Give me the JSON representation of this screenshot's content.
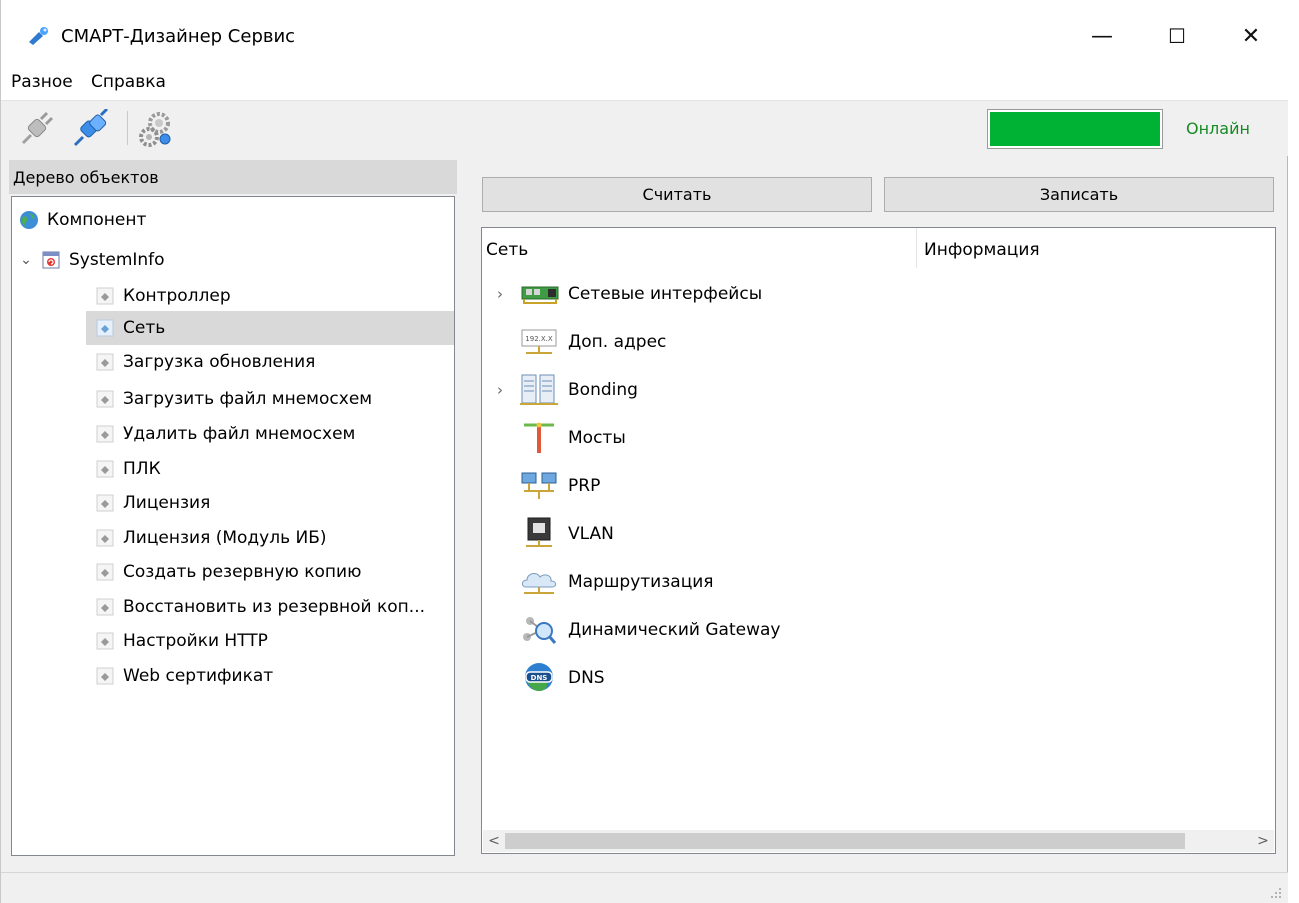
{
  "window": {
    "title": "СМАРТ-Дизайнер Сервис",
    "minimize": "—",
    "maximize": "☐",
    "close": "✕"
  },
  "menu": {
    "items": [
      {
        "label": "Разное"
      },
      {
        "label": "Справка"
      }
    ]
  },
  "toolbar": {
    "tools": [
      {
        "icon": "disconnect-plug-icon"
      },
      {
        "icon": "connect-plug-icon"
      },
      {
        "icon": "gear-icon"
      }
    ],
    "status": {
      "label": "Онлайн",
      "color": "#00b233",
      "fill": 1.0
    }
  },
  "left_panel": {
    "header": "Дерево объектов",
    "tree": {
      "root": {
        "label": "Компонент",
        "icon": "globe-icon"
      },
      "group": {
        "label": "SystemInfo",
        "icon": "systeminfo-icon",
        "expanded": true
      },
      "items": [
        {
          "label": "Контроллер",
          "selected": false
        },
        {
          "label": "Сеть",
          "selected": true
        },
        {
          "label": "Загрузка обновления",
          "selected": false
        },
        {
          "label": "Загрузить файл мнемосхем",
          "selected": false
        },
        {
          "label": "Удалить файл мнемосхем",
          "selected": false
        },
        {
          "label": "ПЛК",
          "selected": false
        },
        {
          "label": "Лицензия",
          "selected": false
        },
        {
          "label": "Лицензия (Модуль ИБ)",
          "selected": false
        },
        {
          "label": "Создать резервную копию",
          "selected": false
        },
        {
          "label": "Восстановить из резервной коп...",
          "selected": false
        },
        {
          "label": "Настройки HTTP",
          "selected": false
        },
        {
          "label": "Web сертификат",
          "selected": false
        }
      ]
    }
  },
  "right_panel": {
    "read_button": "Считать",
    "write_button": "Записать",
    "columns": [
      "Сеть",
      "Информация"
    ],
    "rows": [
      {
        "label": "Сетевые интерфейсы",
        "icon": "network-card-icon",
        "expandable": true
      },
      {
        "label": "Доп. адрес",
        "icon": "ip-address-icon",
        "icon_text": "192.X.X",
        "expandable": false
      },
      {
        "label": "Bonding",
        "icon": "bonding-icon",
        "expandable": true
      },
      {
        "label": "Мосты",
        "icon": "bridge-icon",
        "expandable": false
      },
      {
        "label": "PRP",
        "icon": "prp-network-icon",
        "expandable": false
      },
      {
        "label": "VLAN",
        "icon": "vlan-icon",
        "expandable": false
      },
      {
        "label": "Маршрутизация",
        "icon": "routing-cloud-icon",
        "expandable": false
      },
      {
        "label": "Динамический Gateway",
        "icon": "dynamic-gateway-icon",
        "expandable": false
      },
      {
        "label": "DNS",
        "icon": "dns-icon",
        "icon_text": "DNS",
        "expandable": false
      }
    ]
  }
}
